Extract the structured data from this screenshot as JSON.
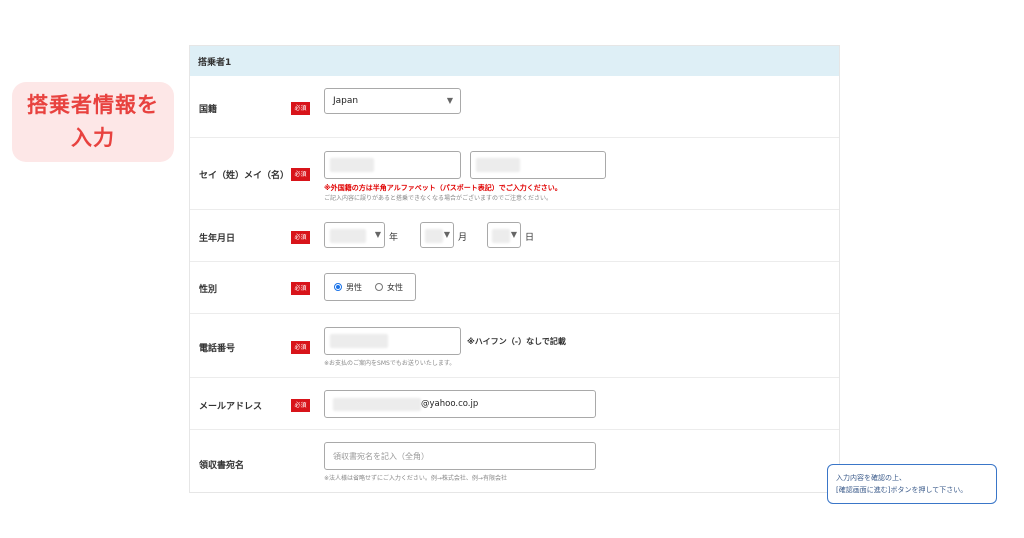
{
  "callout": {
    "line1": "搭乗者情報を",
    "line2": "入力"
  },
  "form": {
    "header": "搭乗者1",
    "required_badge": "必須",
    "nationality": {
      "label": "国籍",
      "value": "Japan"
    },
    "name": {
      "label": "セイ（姓）メイ（名）",
      "note_red": "※外国籍の方は半角アルファベット（パスポート表記）でご入力ください。",
      "note_gray": "ご記入内容に誤りがあると搭乗できなくなる場合がございますのでご注意ください。"
    },
    "birthdate": {
      "label": "生年月日",
      "year_unit": "年",
      "month_unit": "月",
      "day_unit": "日"
    },
    "gender": {
      "label": "性別",
      "options": [
        "男性",
        "女性"
      ],
      "selected": "男性"
    },
    "phone": {
      "label": "電話番号",
      "hint": "※ハイフン（-）なしで記載",
      "note": "※お支払のご案内をSMSでもお送りいたします。"
    },
    "email": {
      "label": "メールアドレス",
      "value_suffix": "@yahoo.co.jp"
    },
    "receipt": {
      "label": "領収書宛名",
      "placeholder": "領収書宛名を記入（全角）",
      "note": "※法人様は省略せずにご入力ください。例→株式会社、例→有限会社"
    }
  },
  "tooltip": {
    "line1": "入力内容を確認の上、",
    "line2": "[確認画面に進む]ボタンを押して下さい。"
  },
  "colors": {
    "accent": "#e8423f",
    "required": "#d8141a",
    "header_bg": "#deeff6",
    "radio": "#1a73e8"
  }
}
